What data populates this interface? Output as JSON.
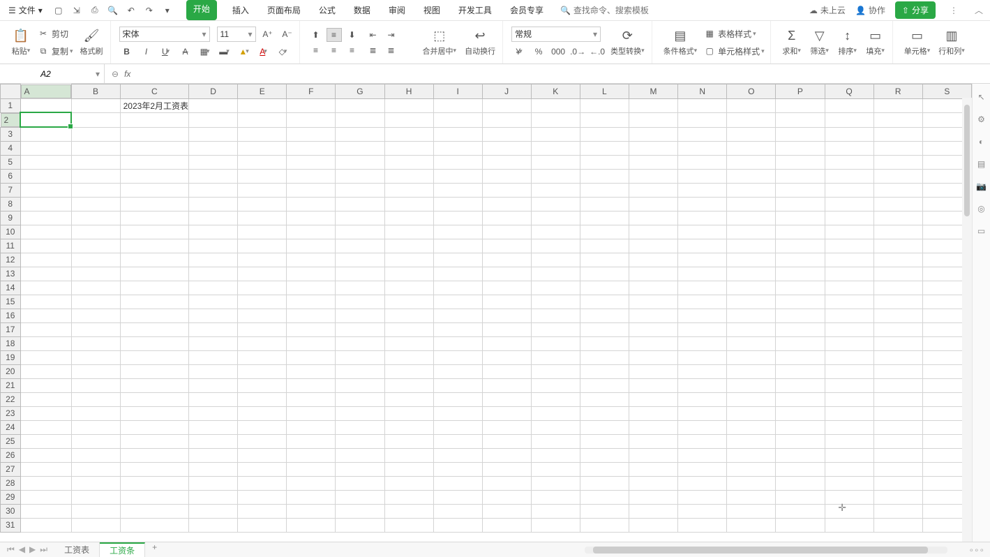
{
  "menubar": {
    "file_label": "文件",
    "menus": [
      "开始",
      "插入",
      "页面布局",
      "公式",
      "数据",
      "审阅",
      "视图",
      "开发工具",
      "会员专享"
    ],
    "active_menu": "开始",
    "search_placeholder": "查找命令、搜索模板",
    "cloud_label": "未上云",
    "collab_label": "协作",
    "share_label": "分享"
  },
  "ribbon": {
    "paste": "粘贴",
    "cut": "剪切",
    "copy": "复制",
    "format_painter": "格式刷",
    "font_name": "宋体",
    "font_size": "11",
    "merge_center": "合并居中",
    "wrap_text": "自动换行",
    "number_format": "常规",
    "type_convert": "类型转换",
    "cond_fmt": "条件格式",
    "table_style": "表格样式",
    "cell_style": "单元格样式",
    "sum": "求和",
    "filter": "筛选",
    "sort": "排序",
    "fill": "填充",
    "cell": "单元格",
    "rowcol": "行和列"
  },
  "formula_bar": {
    "cell_ref": "A2",
    "fx_label": "fx",
    "formula": ""
  },
  "sheet": {
    "columns": [
      "A",
      "B",
      "C",
      "D",
      "E",
      "F",
      "G",
      "H",
      "I",
      "J",
      "K",
      "L",
      "M",
      "N",
      "O",
      "P",
      "Q",
      "R",
      "S"
    ],
    "rows": 31,
    "selected_col": "A",
    "selected_row": 2,
    "data": {
      "r1c3": "2023年2月工资表"
    }
  },
  "tabs": {
    "sheets": [
      "工资表",
      "工资条"
    ],
    "active": "工资条",
    "add": "+"
  }
}
